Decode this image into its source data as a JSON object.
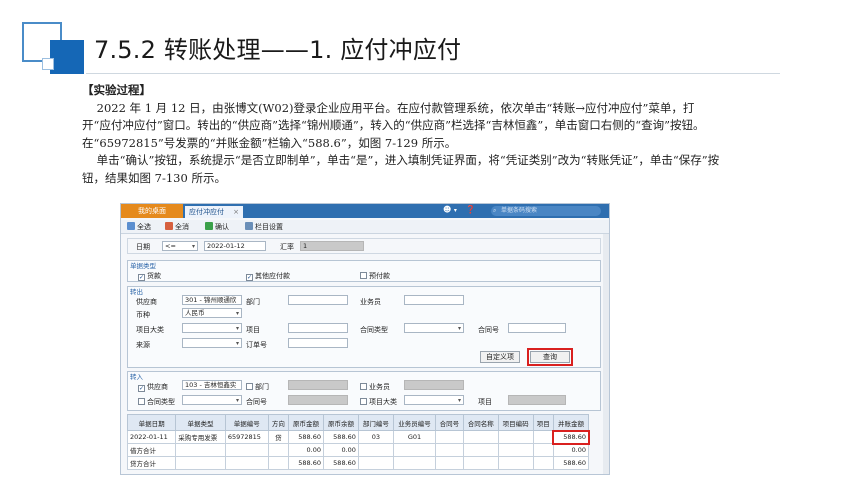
{
  "slide": {
    "title": "7.5.2  转账处理——1. 应付冲应付"
  },
  "text": {
    "heading": "【实验过程】",
    "para1": "2022 年 1 月 12 日，由张博文(W02)登录企业应用平台。在应付款管理系统，依次单击“转账→应付冲应付”菜单，打开“应付冲应付”窗口。转出的“供应商”选择“锦州顺通”，转入的“供应商”栏选择“吉林恒鑫”，单击窗口右侧的“查询”按钮。在“65972815”号发票的“并账金额”栏输入“588.6”，如图 7-129 所示。",
    "para2": "单击“确认”按钮，系统提示“是否立即制单”，单击“是”，进入填制凭证界面，将“凭证类别”改为“转账凭证”，单击“保存”按钮，结果如图 7-130 所示。"
  },
  "window": {
    "tab_home": "我的桌面",
    "tab_active": "应付冲应付",
    "tab_close": "×",
    "search_placeholder": "单据条码搜索",
    "toolbar": {
      "select_all": "全选",
      "deselect_all": "全消",
      "confirm": "确认",
      "column_settings": "栏目设置"
    },
    "header": {
      "date_label": "日期",
      "date_op": "<=",
      "date_value": "2022-01-12",
      "rate_label": "汇率",
      "rate_value": "1"
    },
    "doc_type": {
      "title": "单据类型",
      "opt1": "货款",
      "opt2": "其他应付款",
      "opt3": "预付款",
      "opt1_checked": true,
      "opt2_checked": true,
      "opt3_checked": false
    },
    "transfer_out": {
      "title": "转出",
      "supplier_label": "供应商",
      "supplier_value": "301 - 锦州顺通欣",
      "dept_label": "部门",
      "salesman_label": "业务员",
      "currency_label": "币种",
      "currency_value": "人民币",
      "project_type_label": "项目大类",
      "project_label": "项目",
      "contract_type_label": "合同类型",
      "contract_no_label": "合同号",
      "source_label": "来源",
      "order_no_label": "订单号",
      "custom_button": "自定义项",
      "query_button": "查询"
    },
    "transfer_in": {
      "title": "转入",
      "supplier_label": "供应商",
      "supplier_value": "103 - 吉林恒鑫实",
      "dept_label": "部门",
      "salesman_label": "业务员",
      "contract_type_label": "合同类型",
      "contract_no_label": "合同号",
      "project_type_label": "项目大类",
      "project_label": "项目"
    },
    "grid": {
      "columns": [
        "单据日期",
        "单据类型",
        "单据编号",
        "方向",
        "原币金额",
        "原币余额",
        "部门编号",
        "业务员编号",
        "合同号",
        "合同名称",
        "项目编码",
        "项目",
        "并账金额"
      ],
      "rows": [
        [
          "2022-01-11",
          "采购专用发票",
          "65972815",
          "贷",
          "588.60",
          "588.60",
          "03",
          "G01",
          "",
          "",
          "",
          "",
          "588.60"
        ],
        [
          "借方合计",
          "",
          "",
          "",
          "0.00",
          "0.00",
          "",
          "",
          "",
          "",
          "",
          "",
          "0.00"
        ],
        [
          "贷方合计",
          "",
          "",
          "",
          "588.60",
          "588.60",
          "",
          "",
          "",
          "",
          "",
          "",
          "588.60"
        ]
      ]
    }
  },
  "colors": {
    "accent_blue": "#1567b6",
    "highlight_red": "#d9201f",
    "home_tab_orange": "#e58a1d"
  }
}
